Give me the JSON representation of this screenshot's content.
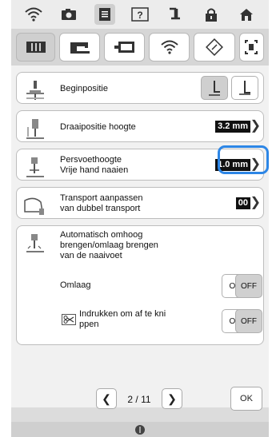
{
  "status_icons": [
    "wifi-icon",
    "camera-icon",
    "document-icon",
    "help-icon",
    "thread-icon",
    "lock-icon",
    "home-icon"
  ],
  "tabs": [
    "machine-settings-icon",
    "sewing-machine-icon",
    "embroidery-frame-icon",
    "wifi-icon",
    "eco-icon",
    "screen-icon"
  ],
  "rows": {
    "begin": {
      "label": "Beginpositie"
    },
    "pivot": {
      "label": "Draaipositie hoogte",
      "value": "3.2 mm"
    },
    "presser": {
      "label_line1": "Persvoethoogte",
      "label_line2": "Vrije hand naaien",
      "value": "1.0 mm"
    },
    "transport": {
      "label_line1": "Transport aanpassen",
      "label_line2": "van dubbel transport",
      "value": "00"
    },
    "auto": {
      "label_line1": "Automatisch omhoog",
      "label_line2": "brengen/omlaag brengen",
      "label_line3": "van de naaivoet",
      "omlaag": "Omlaag",
      "press_line1": "Indrukken om af te kni",
      "press_line2": "ppen",
      "on_label": "ON",
      "off_label": "OFF"
    }
  },
  "pagination": {
    "page": "2 / 11",
    "ok": "OK"
  },
  "colors": {
    "highlight": "#2d86e6",
    "value_bg": "#111111"
  }
}
